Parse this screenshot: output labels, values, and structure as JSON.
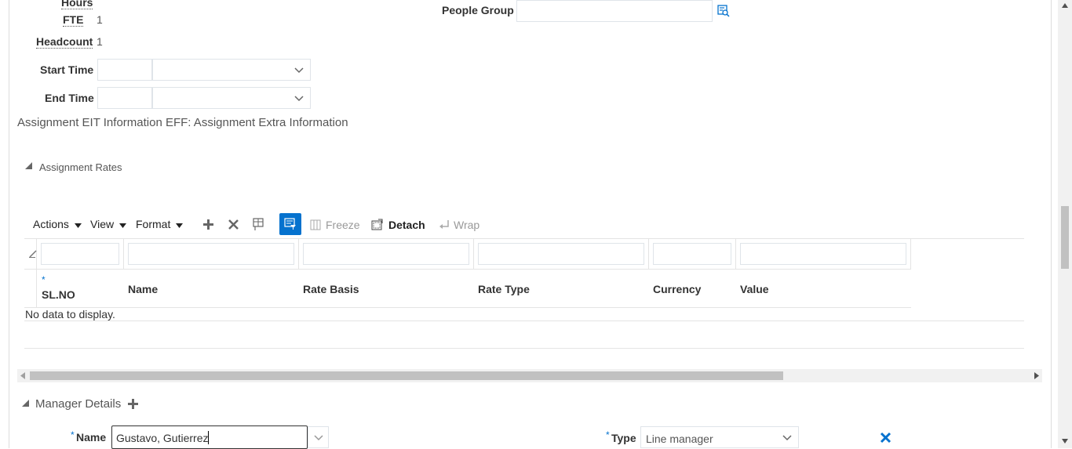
{
  "details": {
    "hours_label": "Hours",
    "fte_label": "FTE",
    "fte_value": "1",
    "headcount_label": "Headcount",
    "headcount_value": "1",
    "start_time_label": "Start Time",
    "end_time_label": "End Time",
    "people_group_label": "People Group",
    "people_group_value": ""
  },
  "eit": {
    "title": "Assignment EIT Information EFF: Assignment Extra Information"
  },
  "rates": {
    "section_title": "Assignment Rates",
    "toolbar": {
      "actions": "Actions",
      "view": "View",
      "format": "Format",
      "freeze": "Freeze",
      "detach": "Detach",
      "wrap": "Wrap"
    },
    "columns": {
      "required_marker": "*",
      "slno": "Sl.NO",
      "name": "Name",
      "rate_basis": "Rate Basis",
      "rate_type": "Rate Type",
      "currency": "Currency",
      "value": "Value"
    },
    "empty_text": "No data to display."
  },
  "manager": {
    "section_title": "Manager Details",
    "name_required": "*",
    "name_label": "Name",
    "name_value": "Gustavo, Gutierrez",
    "type_required": "*",
    "type_label": "Type",
    "type_value": "Line manager"
  },
  "colors": {
    "accent": "#0572ce",
    "text": "#333333",
    "border": "#dfe4e9"
  }
}
